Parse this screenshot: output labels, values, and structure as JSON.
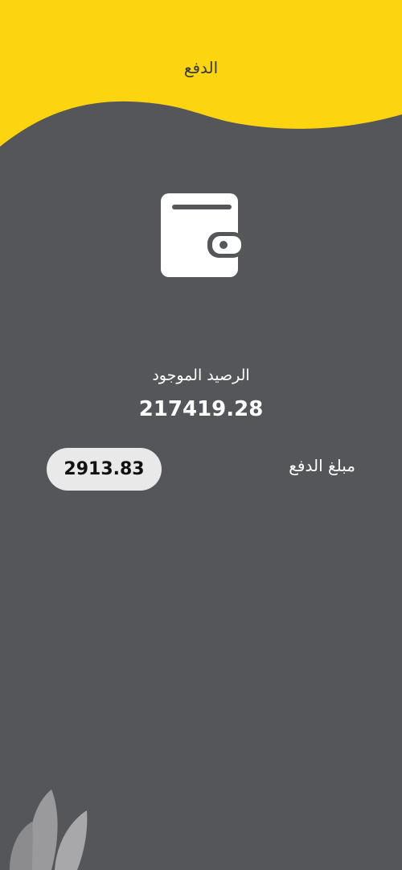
{
  "header": {
    "title": "الدفع",
    "bg_color": "#fdd410"
  },
  "wallet": {
    "icon": "wallet-icon",
    "balance_label": "الرصيد الموجود",
    "balance_value": "217419.28"
  },
  "payment": {
    "label": "مبلغ الدفع",
    "amount": "2913.83"
  },
  "colors": {
    "background": "#55565a",
    "accent": "#fdd410",
    "pill": "#e9e9e9"
  },
  "decoration": {
    "icon": "leaf-icon"
  }
}
